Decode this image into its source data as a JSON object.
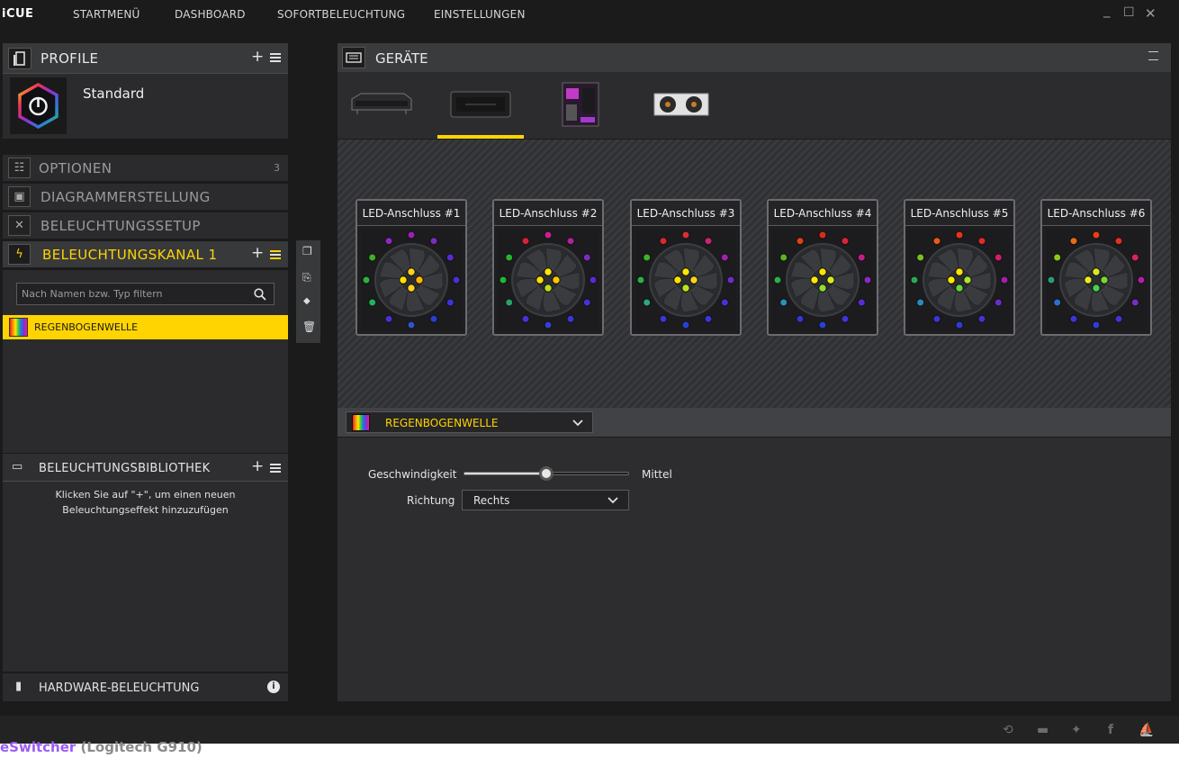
{
  "app": {
    "logo": "iCUE"
  },
  "nav": {
    "items": [
      "STARTMENÜ",
      "DASHBOARD",
      "SOFORTBELEUCHTUNG",
      "EINSTELLUNGEN"
    ]
  },
  "window_controls": {
    "minimize": "_",
    "maximize": "☐",
    "close": "✕"
  },
  "profile": {
    "header": "PROFILE",
    "plus": "+",
    "name": "Standard"
  },
  "sections": {
    "options_label": "OPTIONEN",
    "options_count": "3",
    "diagram_label": "DIAGRAMMERSTELLUNG",
    "setup_label": "BELEUCHTUNGSSETUP",
    "channel_label": "BELEUCHTUNGSKANAL 1",
    "channel_plus": "+"
  },
  "filter": {
    "placeholder": "Nach Namen bzw. Typ filtern"
  },
  "effect_list": {
    "item": "REGENBOGENWELLE"
  },
  "library": {
    "title": "BELEUCHTUNGSBIBLIOTHEK",
    "plus": "+",
    "hint_line1": "Klicken Sie auf \"+\", um einen neuen",
    "hint_line2": "Beleuchtungseffekt hinzuzufügen"
  },
  "hardware": {
    "label": "HARDWARE-BELEUCHTUNG",
    "info": "i"
  },
  "devices": {
    "title": "GERÄTE",
    "selected_index": 1
  },
  "ports": [
    {
      "label": "LED-Anschluss #1",
      "ring": [
        "#9a1fb5",
        "#7c2cc0",
        "#5b2ad0",
        "#4a2fd6",
        "#3b33d8",
        "#2a3fd4",
        "#2e52d0",
        "#4a2fd6",
        "#22b35a",
        "#2fb23c",
        "#3fb026",
        "#8e28c4"
      ],
      "hub": [
        "#ffd21a",
        "#ffb400",
        "#ffd21a",
        "#ffe000"
      ]
    },
    {
      "label": "LED-Anschluss #2",
      "ring": [
        "#c8208c",
        "#b0229b",
        "#7c2cc0",
        "#5b2ad0",
        "#4433d6",
        "#3a37d8",
        "#3440d4",
        "#4a30d6",
        "#2ca066",
        "#22b538",
        "#27b22e",
        "#d8203a"
      ],
      "hub": [
        "#ffe400",
        "#ffc800",
        "#b6e21a",
        "#ffe000"
      ]
    },
    {
      "label": "LED-Anschluss #3",
      "ring": [
        "#d83030",
        "#c82474",
        "#a21fae",
        "#6b2cc8",
        "#4d31d4",
        "#3a36d8",
        "#2c3fd4",
        "#3a36d8",
        "#2ca87e",
        "#2bb046",
        "#3fb228",
        "#d82a2a"
      ],
      "hub": [
        "#ffe400",
        "#ffd21a",
        "#b8e41a",
        "#ffe000"
      ]
    },
    {
      "label": "LED-Anschluss #4",
      "ring": [
        "#e02a18",
        "#d82438",
        "#c0208a",
        "#8e28c4",
        "#5a2cd0",
        "#3e34d8",
        "#2c3ed4",
        "#3637d6",
        "#2a90b8",
        "#2bb046",
        "#58b622",
        "#e04018"
      ],
      "hub": [
        "#ffe400",
        "#d8e820",
        "#8ee030",
        "#ffe800"
      ]
    },
    {
      "label": "LED-Anschluss #5",
      "ring": [
        "#e8341a",
        "#e02a2a",
        "#d01f6a",
        "#a21fae",
        "#6b2cc8",
        "#4433d6",
        "#2f3dd4",
        "#3a36d8",
        "#2a88c0",
        "#2ba858",
        "#78c020",
        "#e85a18"
      ],
      "hub": [
        "#ffe400",
        "#aee42a",
        "#5ed83e",
        "#ffe800"
      ]
    },
    {
      "label": "LED-Anschluss #6",
      "ring": [
        "#ea3e18",
        "#e43020",
        "#d8245a",
        "#b01fa2",
        "#7c2cc0",
        "#4a30d6",
        "#313cd4",
        "#3a36d8",
        "#2c70cc",
        "#2a9a78",
        "#8cc81c",
        "#ec6a16"
      ],
      "hub": [
        "#d8e81e",
        "#7ad832",
        "#48d050",
        "#e8ea20"
      ]
    }
  ],
  "effect": {
    "name": "REGENBOGENWELLE"
  },
  "settings": {
    "speed_label": "Geschwindigkeit",
    "speed_value": "Mittel",
    "speed_fraction": 0.5,
    "direction_label": "Richtung",
    "direction_value": "Rechts"
  },
  "colors": {
    "accent": "#ffd400",
    "panel": "#2c2c2e",
    "background": "#1b1b1c"
  },
  "footer_overlay": {
    "part1": "eSwitcher",
    "part2": " (Logitech G910)"
  }
}
